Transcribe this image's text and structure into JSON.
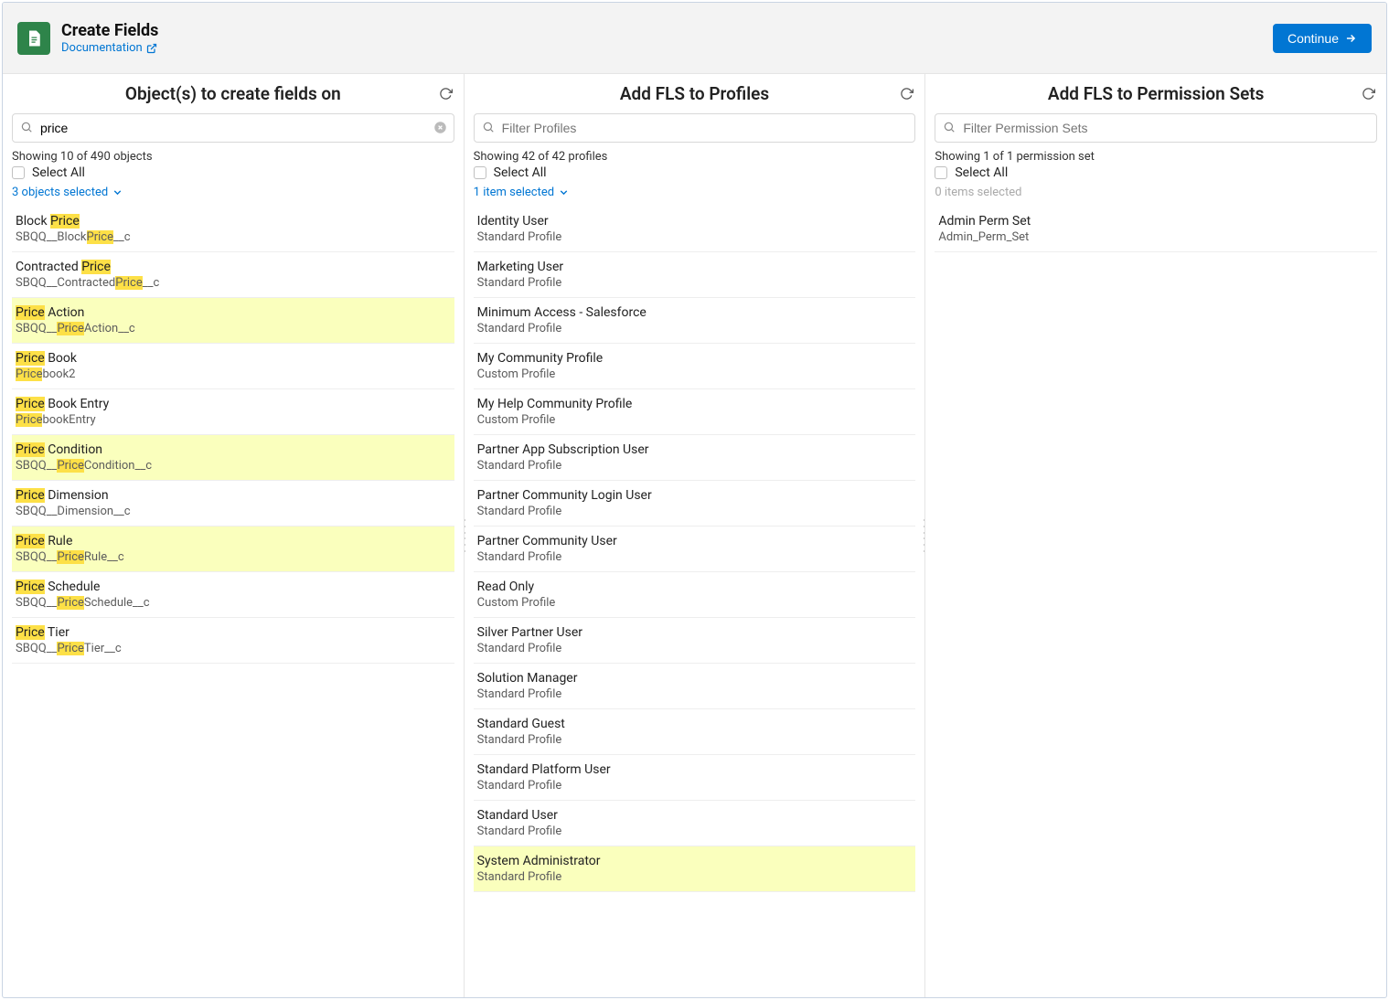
{
  "header": {
    "title": "Create Fields",
    "doc_link": "Documentation",
    "continue": "Continue"
  },
  "objects": {
    "title": "Object(s) to create fields on",
    "search_value": "price",
    "showing": "Showing 10 of 490 objects",
    "select_all": "Select All",
    "selected_text": "3 objects selected",
    "highlight": "Price",
    "items": [
      {
        "label": "Block Price",
        "api": "SBQQ__BlockPrice__c",
        "selected": false
      },
      {
        "label": "Contracted Price",
        "api": "SBQQ__ContractedPrice__c",
        "selected": false
      },
      {
        "label": "Price Action",
        "api": "SBQQ__PriceAction__c",
        "selected": true
      },
      {
        "label": "Price Book",
        "api": "Pricebook2",
        "selected": false
      },
      {
        "label": "Price Book Entry",
        "api": "PricebookEntry",
        "selected": false
      },
      {
        "label": "Price Condition",
        "api": "SBQQ__PriceCondition__c",
        "selected": true
      },
      {
        "label": "Price Dimension",
        "api": "SBQQ__Dimension__c",
        "selected": false
      },
      {
        "label": "Price Rule",
        "api": "SBQQ__PriceRule__c",
        "selected": true
      },
      {
        "label": "Price Schedule",
        "api": "SBQQ__PriceSchedule__c",
        "selected": false
      },
      {
        "label": "Price Tier",
        "api": "SBQQ__PriceTier__c",
        "selected": false
      }
    ]
  },
  "profiles": {
    "title": "Add FLS to Profiles",
    "search_placeholder": "Filter Profiles",
    "showing": "Showing 42 of 42 profiles",
    "select_all": "Select All",
    "selected_text": "1 item selected",
    "items": [
      {
        "label": "Identity User",
        "sub": "Standard Profile",
        "selected": false
      },
      {
        "label": "Marketing User",
        "sub": "Standard Profile",
        "selected": false
      },
      {
        "label": "Minimum Access - Salesforce",
        "sub": "Standard Profile",
        "selected": false
      },
      {
        "label": "My Community Profile",
        "sub": "Custom Profile",
        "selected": false
      },
      {
        "label": "My Help Community Profile",
        "sub": "Custom Profile",
        "selected": false
      },
      {
        "label": "Partner App Subscription User",
        "sub": "Standard Profile",
        "selected": false
      },
      {
        "label": "Partner Community Login User",
        "sub": "Standard Profile",
        "selected": false
      },
      {
        "label": "Partner Community User",
        "sub": "Standard Profile",
        "selected": false
      },
      {
        "label": "Read Only",
        "sub": "Custom Profile",
        "selected": false
      },
      {
        "label": "Silver Partner User",
        "sub": "Standard Profile",
        "selected": false
      },
      {
        "label": "Solution Manager",
        "sub": "Standard Profile",
        "selected": false
      },
      {
        "label": "Standard Guest",
        "sub": "Standard Profile",
        "selected": false
      },
      {
        "label": "Standard Platform User",
        "sub": "Standard Profile",
        "selected": false
      },
      {
        "label": "Standard User",
        "sub": "Standard Profile",
        "selected": false
      },
      {
        "label": "System Administrator",
        "sub": "Standard Profile",
        "selected": true
      }
    ]
  },
  "permsets": {
    "title": "Add FLS to Permission Sets",
    "search_placeholder": "Filter Permission Sets",
    "showing": "Showing 1 of 1 permission set",
    "select_all": "Select All",
    "selected_text": "0 items selected",
    "items": [
      {
        "label": "Admin Perm Set",
        "sub": "Admin_Perm_Set",
        "selected": false
      }
    ]
  }
}
